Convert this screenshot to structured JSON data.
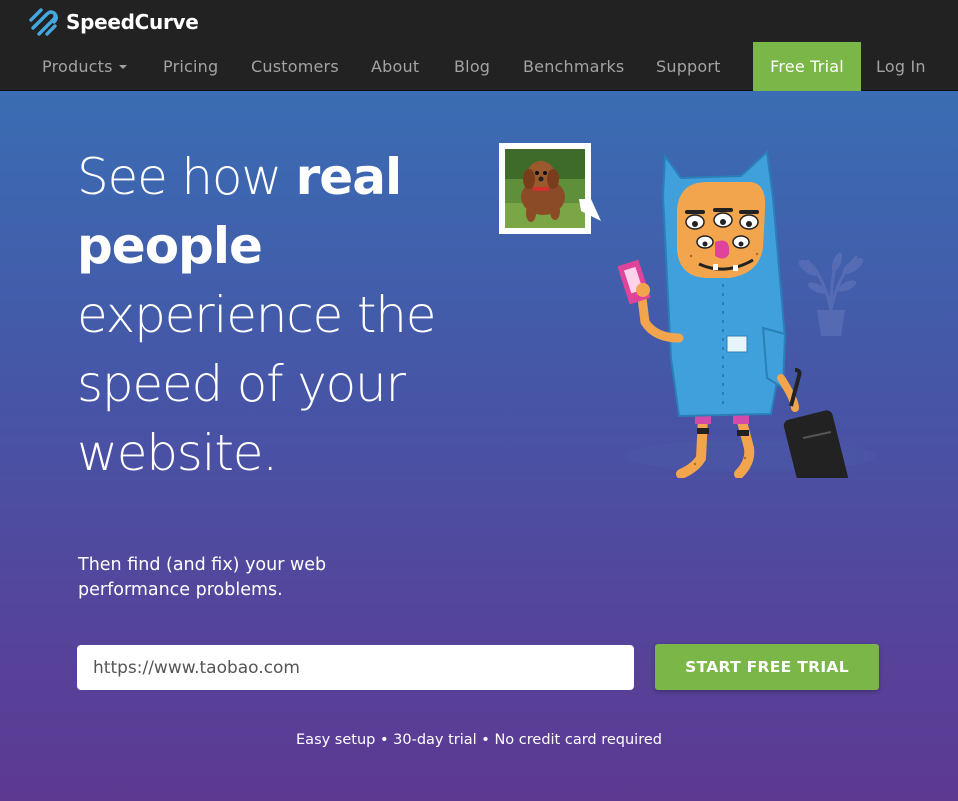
{
  "brand": {
    "name": "SpeedCurve",
    "logo_icon": "speedcurve-logo-icon"
  },
  "nav": {
    "items": [
      {
        "label": "Products",
        "has_dropdown": true
      },
      {
        "label": "Pricing"
      },
      {
        "label": "Customers"
      },
      {
        "label": "About"
      },
      {
        "label": "Blog"
      },
      {
        "label": "Benchmarks"
      },
      {
        "label": "Support"
      }
    ],
    "free_trial_label": "Free Trial",
    "login_label": "Log In"
  },
  "hero": {
    "headline": {
      "part1": "See how",
      "bold1": "real",
      "bold2": "people",
      "part2": "experience the",
      "part3": "speed of your",
      "part4": "website."
    },
    "subhead": "Then find (and fix) your web performance problems.",
    "url_input": {
      "value": "https://www.taobao.com",
      "placeholder": "https://www.taobao.com"
    },
    "cta_label": "START FREE TRIAL",
    "fineprint": "Easy setup • 30-day trial • No credit card required"
  },
  "colors": {
    "topbar_bg": "#222222",
    "nav_text": "#a3a3a3",
    "accent_green": "#7ab648",
    "hero_gradient_top": "#3a6db3",
    "hero_gradient_bottom": "#5d3992",
    "character_blue": "#3fa0dc",
    "character_face": "#f2a54d",
    "card_pink": "#e0449a"
  },
  "illustration": {
    "character": "traveler-monster-illustration",
    "speech_photo": "dog-photo-speech-bubble",
    "plant": "potted-plant-icon",
    "suitcase": "suitcase-icon"
  }
}
